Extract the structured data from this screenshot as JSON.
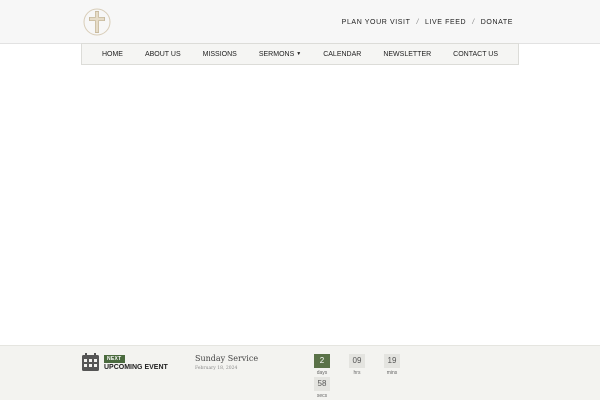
{
  "header": {
    "links": [
      {
        "label": "PLAN YOUR VISIT"
      },
      {
        "label": "LIVE FEED"
      },
      {
        "label": "DONATE"
      }
    ],
    "separator": "/"
  },
  "nav": {
    "items": [
      {
        "label": "HOME"
      },
      {
        "label": "ABOUT US"
      },
      {
        "label": "MISSIONS"
      },
      {
        "label": "SERMONS",
        "has_dropdown": true
      },
      {
        "label": "CALENDAR"
      },
      {
        "label": "NEWSLETTER"
      },
      {
        "label": "CONTACT US"
      }
    ]
  },
  "event": {
    "badge": "NEXT",
    "heading": "UPCOMING EVENT",
    "title": "Sunday Service",
    "date": "February 18, 2024",
    "countdown": [
      {
        "value": "2",
        "unit": "days"
      },
      {
        "value": "09",
        "unit": "hrs"
      },
      {
        "value": "19",
        "unit": "mins"
      },
      {
        "value": "58",
        "unit": "secs"
      }
    ]
  },
  "colors": {
    "accent_green": "#4a6a3e",
    "header_bg": "#f7f7f7",
    "eventbar_bg": "#f3f3f0"
  }
}
